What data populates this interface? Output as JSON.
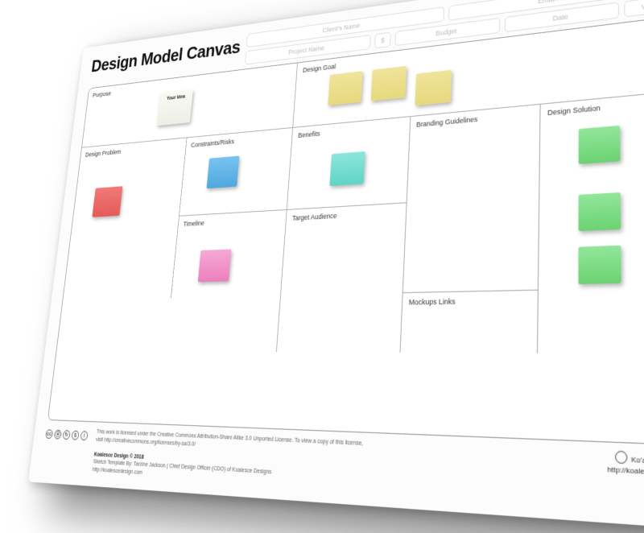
{
  "title": "Design Model Canvas",
  "header_fields": {
    "client_name": "Client's Name",
    "email": "Email Address",
    "project_name": "Project Name",
    "currency": "$",
    "budget": "Budget",
    "date": "Date",
    "version": "Version"
  },
  "sections": {
    "purpose": "Purpose",
    "design_goal": "Design Goal",
    "design_problem": "Design Problem",
    "constraints": "Constraints/Risks",
    "benefits": "Benefits",
    "branding": "Branding Guidelines",
    "design_solution": "Design Solution",
    "timeline": "Timeline",
    "target_audience": "Target Audience",
    "mockups": "Mockups Links"
  },
  "idea_note": "Your Idea",
  "footer": {
    "license_line1": "This work is licensed under the Creative Commons Attribution-Share Alike 3.0 Unported License. To view a copy of this license,",
    "license_line2": "visit http://creativecommons.org/licenses/by-sa/3.0/",
    "copyright": "Koalesce Design © 2018",
    "credit": "Sketch Template By: Tarzine Jackson | Chief Design Officer (CDO) of Koalesce Designs",
    "site": "http://koalescedesign.com",
    "brand_name": "Ko'a'lesce Designs",
    "brand_url": "http://koalescedesign.com"
  }
}
